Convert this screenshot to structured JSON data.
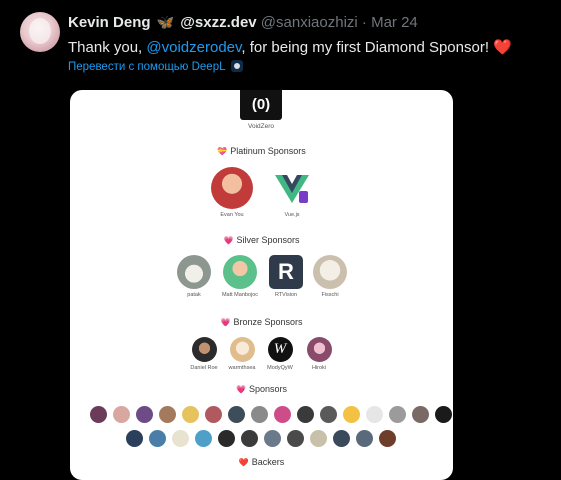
{
  "tweet": {
    "author_name": "Kevin Deng",
    "author_badge": "🦋",
    "author_name_suffix": "@sxzz.dev",
    "handle": "@sanxiaozhizi",
    "separator": "·",
    "date": "Mar 24",
    "text_before": "Thank you, ",
    "mention": "@voidzerodev",
    "text_after": ", for being my first Diamond Sponsor! ",
    "heart": "❤️",
    "translate_link": "Перевести с помощью DeepL"
  },
  "card": {
    "logo_text": "(0)",
    "logo_label": "VoidZero",
    "sections": {
      "platinum": {
        "emoji": "💝",
        "title": "Platinum Sponsors"
      },
      "silver": {
        "emoji": "💗",
        "title": "Silver Sponsors"
      },
      "bronze": {
        "emoji": "💗",
        "title": "Bronze Sponsors"
      },
      "sponsors": {
        "emoji": "💗",
        "title": "Sponsors"
      },
      "backers": {
        "emoji": "❤️",
        "title": "Backers"
      }
    },
    "platinum": [
      {
        "name": "Evan You",
        "color": "#c23b3b"
      },
      {
        "name": "Vue.js",
        "color": "#41b883"
      }
    ],
    "silver": [
      {
        "name": "patak",
        "color": "#9aa59c"
      },
      {
        "name": "Matt Manbojoc",
        "color": "#5cc08a"
      },
      {
        "name": "RTVision",
        "color": "#2f3a4a"
      },
      {
        "name": "Fisschi",
        "color": "#d9d2c8"
      }
    ],
    "bronze": [
      {
        "name": "Daniel Roe",
        "color": "#2b2b2b"
      },
      {
        "name": "warmthsea",
        "color": "#e6cba8"
      },
      {
        "name": "ModyQyW",
        "color": "#111111"
      },
      {
        "name": "Hiroki",
        "color": "#b76a8a"
      }
    ],
    "sponsor_row1_colors": [
      "#6b3b5a",
      "#d8a7a0",
      "#6d4b86",
      "#a47a5e",
      "#e7c35e",
      "#b0595e",
      "#3d4d5a",
      "#8a8a8a",
      "#cf4c8a",
      "#3a3a3a",
      "#5a5a5a",
      "#f3c244",
      "#e6e6e6",
      "#9b9b9b",
      "#7a6a66",
      "#1a1a1a"
    ],
    "sponsor_row2_colors": [
      "#2b3f5c",
      "#4a7ea8",
      "#e8e2d0",
      "#4fa0c8",
      "#2a2a2a",
      "#3b3b3b",
      "#6a7a8a",
      "#4a4a4a",
      "#c8c0a8",
      "#3a4a5a",
      "#5a6a7a",
      "#6d3f2a"
    ]
  }
}
